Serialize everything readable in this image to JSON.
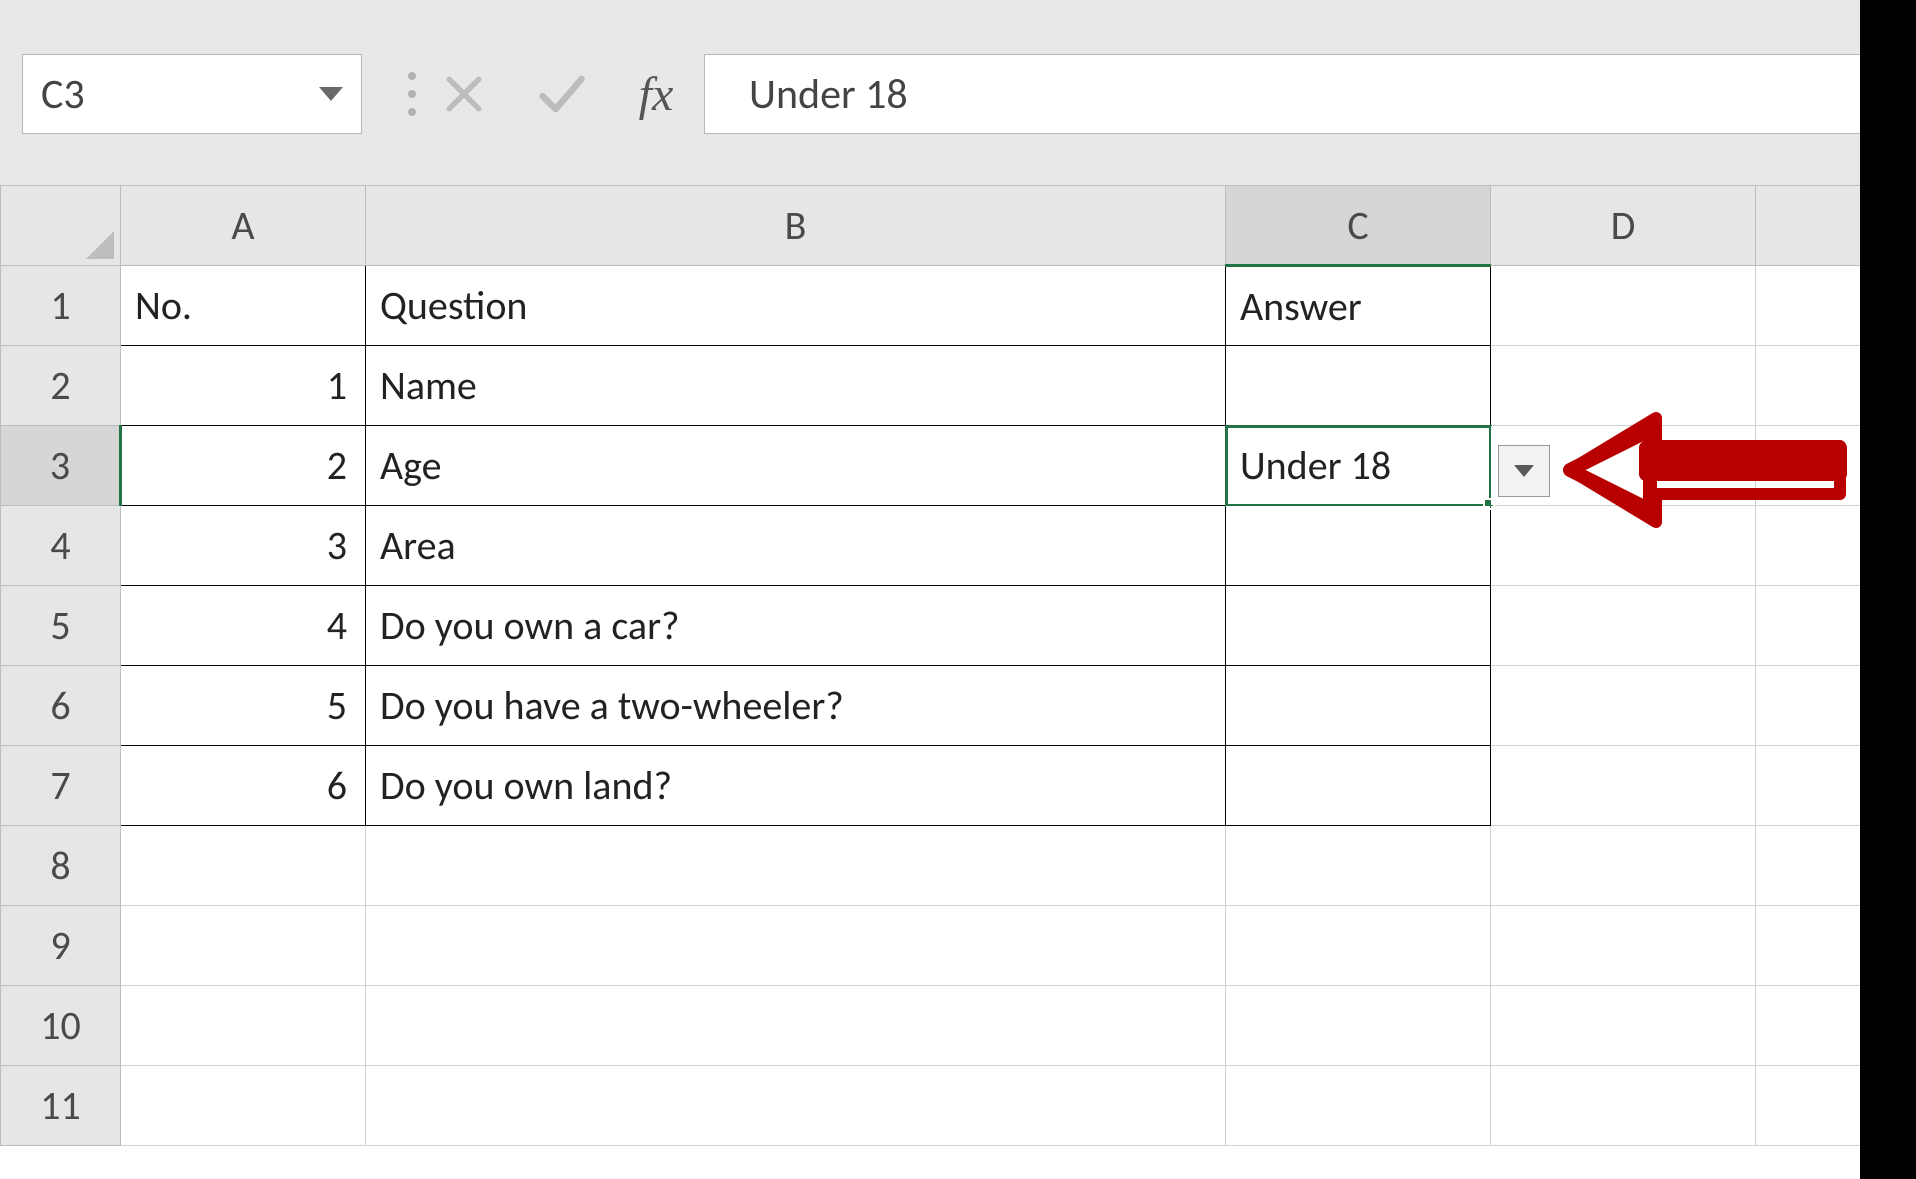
{
  "formula_bar": {
    "name_box": "C3",
    "cancel_label": "✕",
    "enter_label": "✓",
    "fx_label": "fx",
    "value": "Under 18"
  },
  "columns": {
    "a": "A",
    "b": "B",
    "c": "C",
    "d": "D"
  },
  "rows": [
    "1",
    "2",
    "3",
    "4",
    "5",
    "6",
    "7",
    "8",
    "9",
    "10",
    "11"
  ],
  "headers": {
    "no": "No.",
    "question": "Question",
    "answer": "Answer"
  },
  "data": [
    {
      "no": "1",
      "question": "Name",
      "answer": ""
    },
    {
      "no": "2",
      "question": "Age",
      "answer": "Under 18"
    },
    {
      "no": "3",
      "question": "Area",
      "answer": ""
    },
    {
      "no": "4",
      "question": "Do you own a car?",
      "answer": ""
    },
    {
      "no": "5",
      "question": "Do you have a two-wheeler?",
      "answer": ""
    },
    {
      "no": "6",
      "question": "Do you own land?",
      "answer": ""
    }
  ],
  "selected_cell": "C3",
  "annotation": {
    "type": "arrow-left",
    "color": "#b80000"
  }
}
